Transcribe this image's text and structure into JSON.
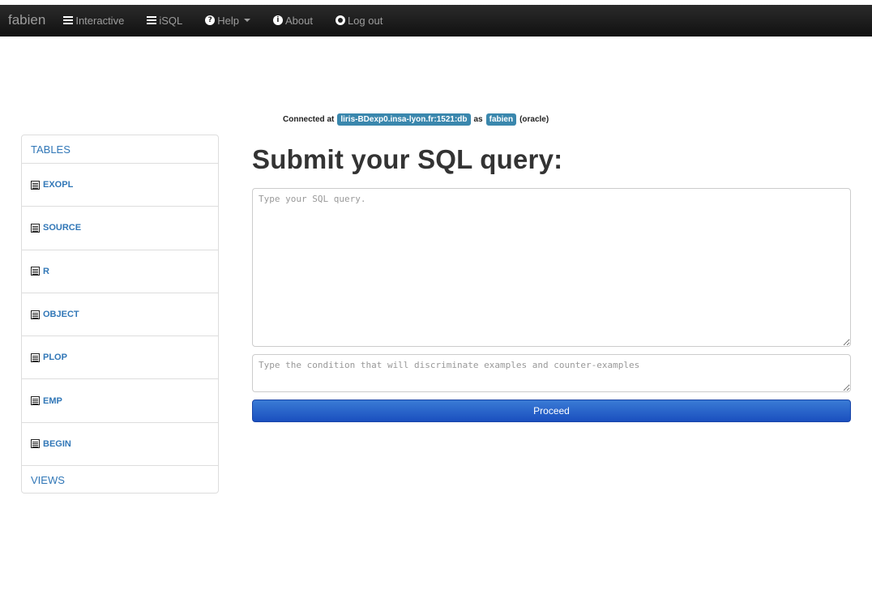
{
  "navbar": {
    "brand": "fabien",
    "items": [
      {
        "label": "Interactive",
        "icon": "list-icon"
      },
      {
        "label": "iSQL",
        "icon": "list-icon"
      },
      {
        "label": "Help",
        "icon": "question-circle-icon",
        "dropdown": true
      },
      {
        "label": "About",
        "icon": "info-circle-icon"
      },
      {
        "label": "Log out",
        "icon": "power-icon"
      }
    ]
  },
  "connection": {
    "prefix": "Connected at",
    "host": "liris-BDexp0.insa-lyon.fr:1521:db",
    "as": "as",
    "user": "fabien",
    "suffix": "(oracle)"
  },
  "sidebar": {
    "header": "TABLES",
    "tables": [
      "EXOPL",
      "SOURCE",
      "R",
      "OBJECT",
      "PLOP",
      "EMP",
      "BEGIN"
    ],
    "footer": "VIEWS"
  },
  "main": {
    "title": "Submit your SQL query:",
    "query_placeholder": "Type your SQL query.",
    "condition_placeholder": "Type the condition that will discriminate examples and counter-examples",
    "proceed_label": "Proceed"
  },
  "colors": {
    "navbar_bg": "#1b1b1b",
    "link": "#3177b7",
    "badge": "#3a87ad",
    "button": "#2a64cc"
  }
}
